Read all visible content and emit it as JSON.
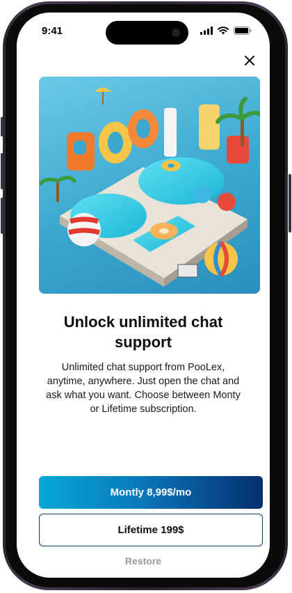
{
  "status_bar": {
    "time": "9:41"
  },
  "hero": {
    "image_alt": "Pool themed 3D illustration"
  },
  "paywall": {
    "title": "Unlock unlimited chat support",
    "description": "Unlimited chat support from PooLex, anytime, anywhere. Just open the chat and ask what you want. Choose between Monty or Lifetime subscription.",
    "monthly_label": "Montly 8,99$/mo",
    "lifetime_label": "Lifetime 199$",
    "restore_label": "Restore"
  },
  "colors": {
    "primary_gradient_start": "#07a8d8",
    "primary_gradient_end": "#062f6e",
    "secondary_border": "#0a3b6e",
    "restore_text": "#9a9a9a"
  }
}
